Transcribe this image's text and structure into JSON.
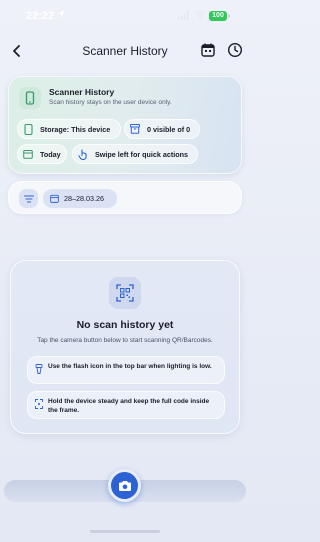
{
  "status_bar": {
    "time": "22:22",
    "battery": "100"
  },
  "nav": {
    "title": "Scanner History"
  },
  "info_card": {
    "title": "Scanner History",
    "subtitle": "Scan history stays on the user device only.",
    "storage_chip": "Storage: This device",
    "visible_chip": "0 visible of 0",
    "today_chip": "Today",
    "swipe_chip": "Swipe left for quick actions"
  },
  "filter_bar": {
    "date_range": "28–28.03.26"
  },
  "empty_state": {
    "title": "No scan history yet",
    "subtitle": "Tap the camera button below to start scanning QR/Barcodes.",
    "tips": [
      "Use the flash icon in the top bar when lighting is low.",
      "Hold the device steady and keep the full code inside the frame."
    ]
  },
  "colors": {
    "accent": "#2d62d4",
    "green_icon": "#3a9a6e",
    "battery": "#34c759"
  }
}
